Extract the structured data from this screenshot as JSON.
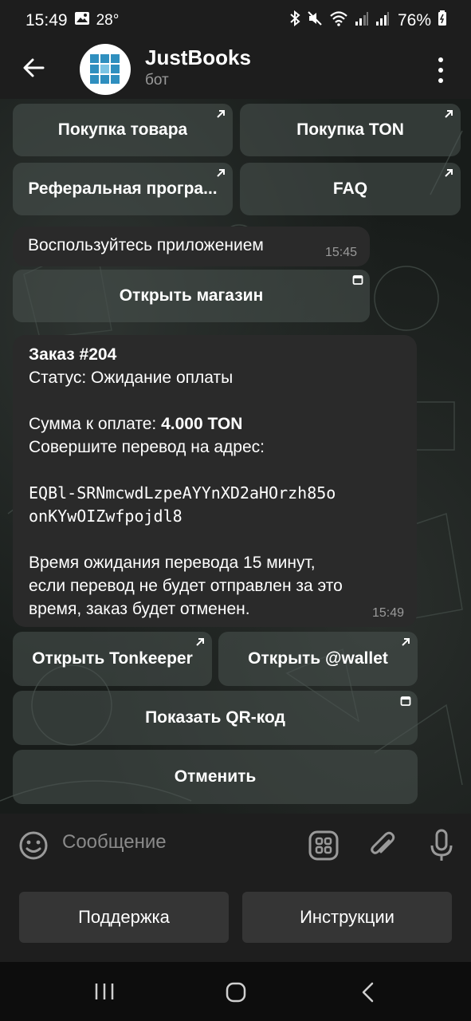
{
  "status_bar": {
    "time": "15:49",
    "temperature": "28°",
    "battery": "76%",
    "icons": [
      "image-icon",
      "bluetooth-icon",
      "mute-icon",
      "wifi-icon",
      "signal-icon",
      "signal-icon",
      "battery-icon"
    ]
  },
  "header": {
    "title": "JustBooks",
    "subtitle": "бот"
  },
  "top_keyboard": {
    "btn_purchase_goods": "Покупка товара",
    "btn_purchase_ton": "Покупка TON",
    "btn_referral": "Реферальная програ...",
    "btn_faq": "FAQ"
  },
  "message_app": {
    "text": "Воспользуйтесь приложением",
    "time": "15:45",
    "button": "Открыть магазин"
  },
  "message_order": {
    "line1": "Заказ #204",
    "line2": "Статус: Ожидание оплаты",
    "amount_label": "Сумма к оплате: ",
    "amount_value": "4.000 TON",
    "line4": "Совершите перевод на адрес:",
    "address_line1": "EQBl-SRNmcwdLzpeAYYnXD2aHOrzh85o",
    "address_line2": "onKYwOIZwfpojdl8",
    "line6": "Время ожидания перевода 15 минут,",
    "line7": "если перевод не будет отправлен за это",
    "line8": "время, заказ будет отменен.",
    "time": "15:49"
  },
  "order_keyboard": {
    "btn_tonkeeper": "Открыть Tonkeeper",
    "btn_wallet": "Открыть @wallet",
    "btn_qr": "Показать QR-код",
    "btn_cancel": "Отменить"
  },
  "input": {
    "placeholder": "Сообщение"
  },
  "reply_keyboard": {
    "btn_support": "Поддержка",
    "btn_instructions": "Инструкции"
  },
  "colors": {
    "bubble": "#2a2a2a",
    "inline_button": "#4a5450",
    "reply_button": "#353535",
    "avatar_logo": "#2f8fbf"
  }
}
